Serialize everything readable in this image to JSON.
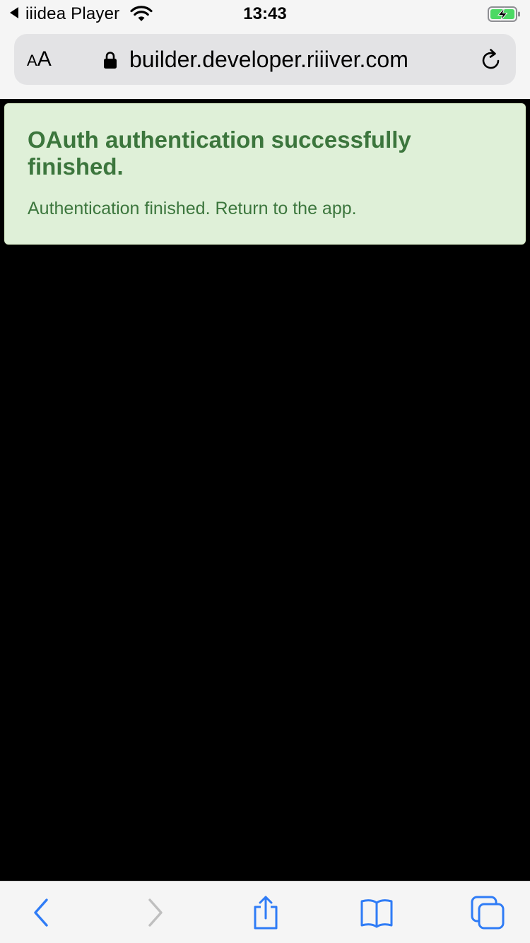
{
  "status_bar": {
    "back_app": "iiidea Player",
    "time": "13:43",
    "icons": [
      "back-triangle-icon",
      "wifi-icon",
      "battery-charging-icon"
    ],
    "battery_color": "#4cd964"
  },
  "address_bar": {
    "text_size_label_small": "A",
    "text_size_label_large": "A",
    "url": "builder.developer.riiiver.com",
    "secure": true,
    "icons": [
      "lock-icon",
      "reload-icon"
    ]
  },
  "page": {
    "alert": {
      "title": "OAuth authentication successfully finished.",
      "message": "Authentication finished. Return to the app.",
      "background_color": "#dff0d8",
      "text_color": "#3c763d"
    },
    "background_color": "#000000"
  },
  "toolbar": {
    "accent_color": "#2f7cf6",
    "disabled_color": "#bfbfbf",
    "buttons": [
      {
        "name": "back",
        "icon": "chevron-left-icon",
        "enabled": true
      },
      {
        "name": "forward",
        "icon": "chevron-right-icon",
        "enabled": false
      },
      {
        "name": "share",
        "icon": "share-icon",
        "enabled": true
      },
      {
        "name": "bookmarks",
        "icon": "book-icon",
        "enabled": true
      },
      {
        "name": "tabs",
        "icon": "tabs-icon",
        "enabled": true
      }
    ]
  }
}
